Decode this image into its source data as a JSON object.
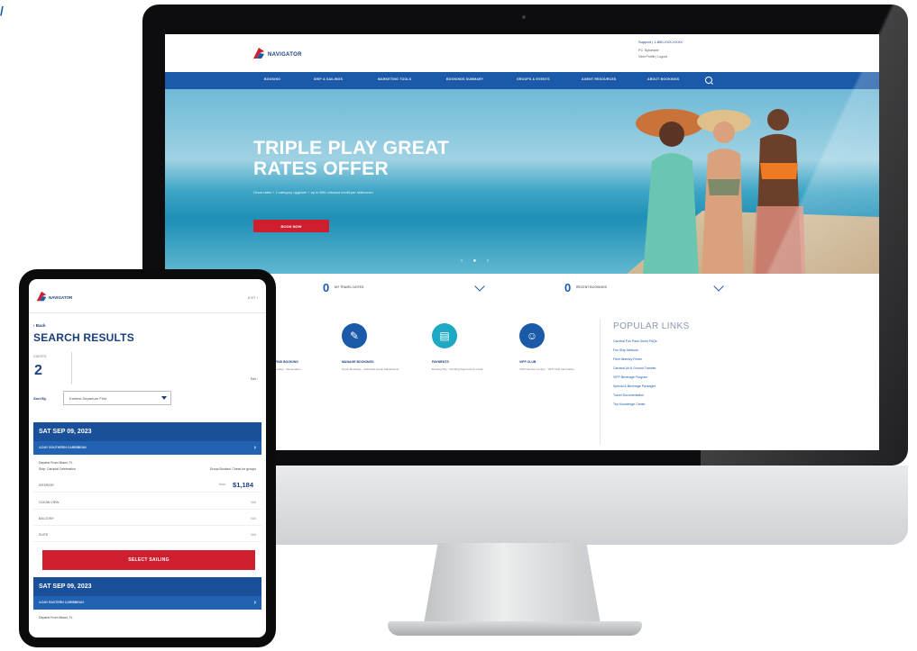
{
  "brand": {
    "logo_text": "NAVIGATOR",
    "accent": "#1a5aa8",
    "cta": "#cf1f2e"
  },
  "corner": {
    "mark": "/"
  },
  "desktop": {
    "header": {
      "support": "Support | 1-800-XXX-XXXX",
      "user": "FC Sylvester",
      "links": "View Profile | Logout"
    },
    "nav": [
      "BOOKING",
      "SHIP & SAILINGS",
      "MARKETING TOOLS",
      "BOOKINGS SUMMARY",
      "GROUPS & EVENTS",
      "AGENT RESOURCES",
      "ABOUT BOOKINGS"
    ],
    "hero": {
      "title": "TRIPLE PLAY GREAT RATES OFFER",
      "subtitle": "Great rates + 2 category upgrade + up to $50 onboard credit per stateroom",
      "button": "BOOK NOW",
      "slider": "‹ ● ›"
    },
    "counters": [
      {
        "value": "0",
        "label": "MY TRAVEL NOTES"
      },
      {
        "value": "0",
        "label": "RECENT BOOKINGS"
      }
    ],
    "tools": [
      {
        "icon": "pencil-icon",
        "glyph": "✎",
        "title": "MANAGE BOOKINGS",
        "desc": "Group Bookings · Individual Group Adjustments"
      },
      {
        "icon": "document-icon",
        "glyph": "▤",
        "title": "PAYMENTS",
        "desc": "Booking Pay · Pending Payments & Credit"
      },
      {
        "icon": "vip-club-icon",
        "glyph": "☺",
        "title": "VIFP CLUB",
        "desc": "VIFP Number Lookup · VIFP Club Information"
      }
    ],
    "partial_tool": {
      "title": "FIND BOOKING",
      "desc": "Lookup · Reservation"
    },
    "popular": {
      "title": "POPULAR LINKS",
      "items": [
        "Carnival Fun Pass Guest FAQs",
        "Fun Ship Network",
        "Fleet Itinerary Finder",
        "Carnival Air & Ground Transfer",
        "VIFP Beverage Program",
        "Special & Beverage Packages",
        "Travel Documentation",
        "Trip Knowledge Center"
      ]
    }
  },
  "tablet": {
    "exit_label": "EXIT ›",
    "back": "‹ Back",
    "title": "SEARCH RESULTS",
    "guests_label": "GUESTS",
    "guests_value": "2",
    "edit_label": "Edit ›",
    "sort_label": "Sort By",
    "sort_value": "Earliest Departure First",
    "cards": [
      {
        "date": "SAT SEP 09, 2023",
        "itinerary": "4-DAY SOUTHERN CARIBBEAN",
        "departs": "Departs From Miami, FL",
        "ship": "Ship: Carnival Celebration",
        "group": "Group Booked: Check for groups",
        "fares": [
          {
            "name": "INTERIOR",
            "from": "from",
            "price": "$1,184"
          },
          {
            "name": "OCEAN VIEW",
            "value": "N/A"
          },
          {
            "name": "BALCONY",
            "value": "N/A"
          },
          {
            "name": "SUITE",
            "value": "N/A"
          }
        ],
        "cta": "SELECT SAILING"
      },
      {
        "date": "SAT SEP 09, 2023",
        "itinerary": "4-DAY EASTERN CARIBBEAN",
        "departs": "Departs From Miami, FL"
      }
    ]
  }
}
